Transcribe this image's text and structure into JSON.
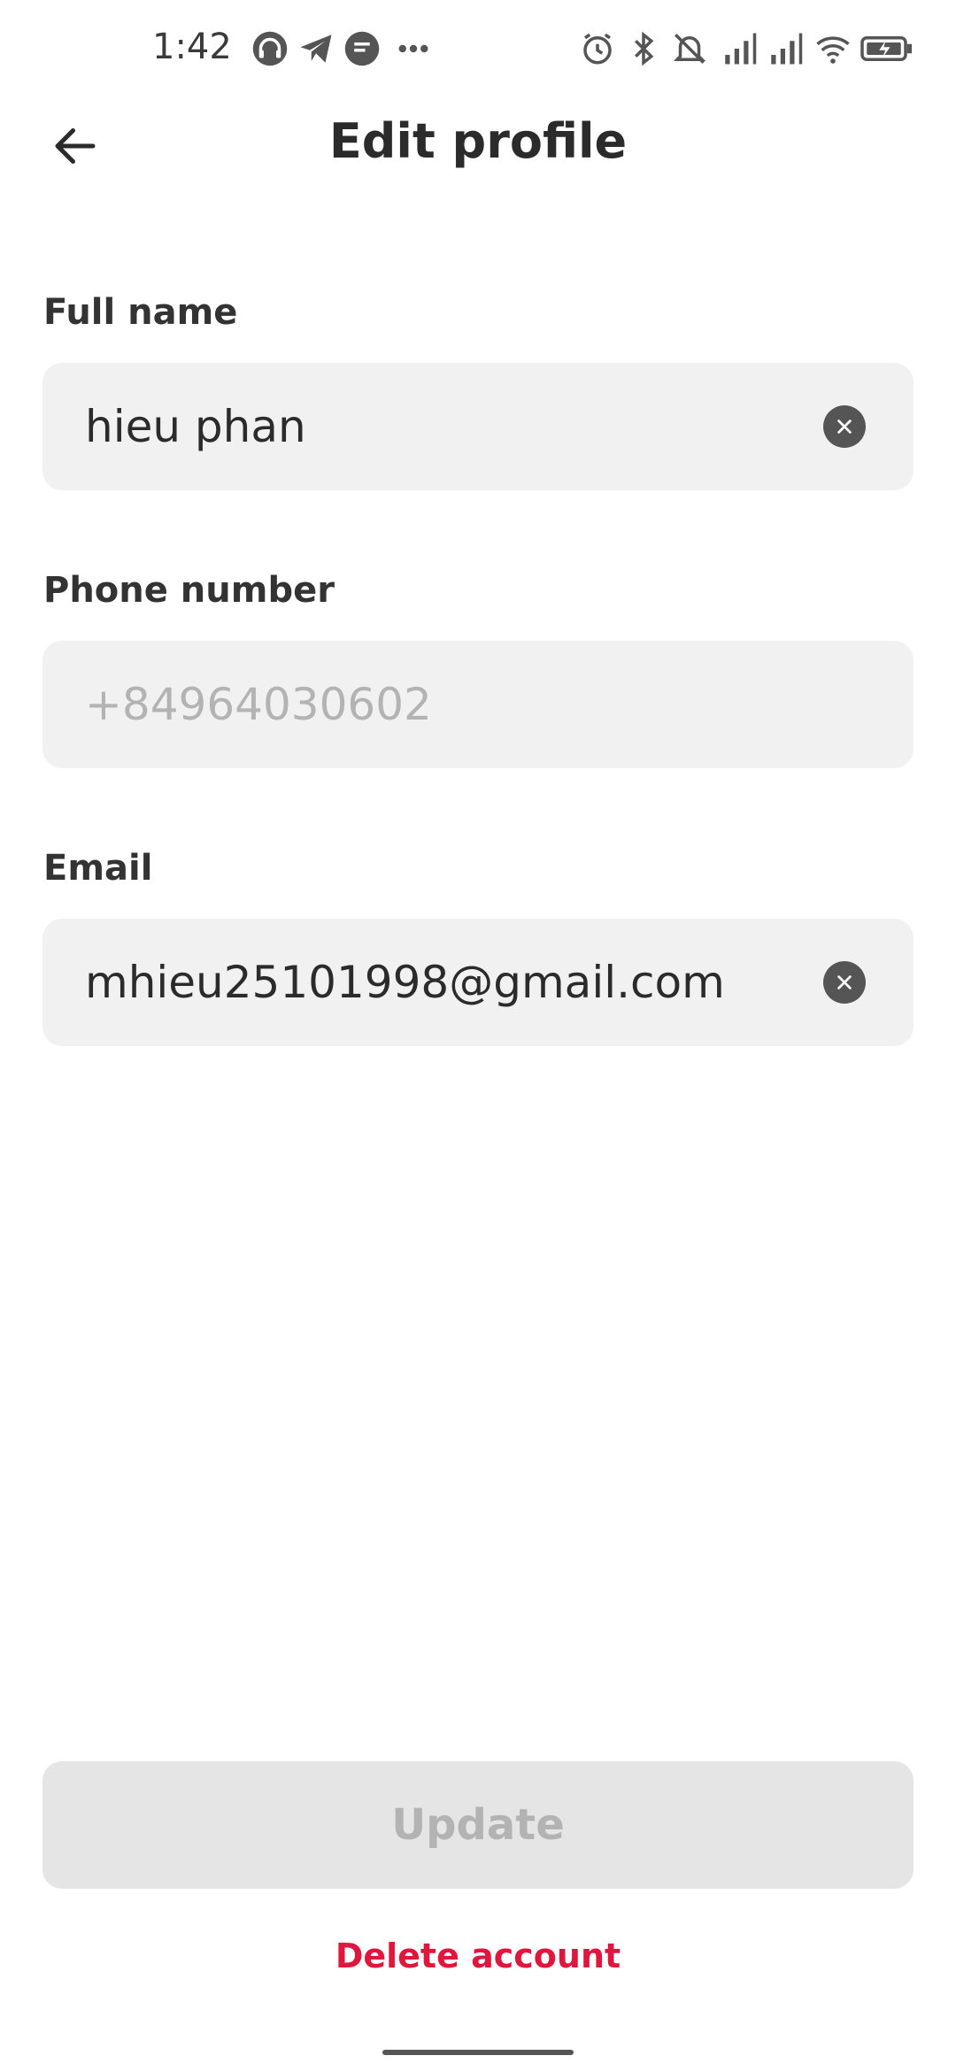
{
  "status_bar": {
    "time": "1:42",
    "left_icons": [
      "headset-icon",
      "telegram-icon",
      "chat-bubble-icon",
      "more-dots-icon"
    ],
    "right_icons": [
      "alarm-icon",
      "bluetooth-icon",
      "bell-off-icon",
      "signal-icon",
      "signal-icon",
      "wifi-icon",
      "battery-charging-icon"
    ]
  },
  "header": {
    "title": "Edit profile",
    "back_icon": "arrow-left-icon"
  },
  "form": {
    "full_name": {
      "label": "Full name",
      "value": "hieu phan"
    },
    "phone": {
      "label": "Phone number",
      "value": "+84964030602"
    },
    "email": {
      "label": "Email",
      "value": "mhieu25101998@gmail.com"
    }
  },
  "actions": {
    "update_label": "Update",
    "delete_label": "Delete account"
  },
  "colors": {
    "accent_red": "#e0163c",
    "field_bg": "#f1f1f1",
    "disabled_button_bg": "#e5e5e5"
  }
}
